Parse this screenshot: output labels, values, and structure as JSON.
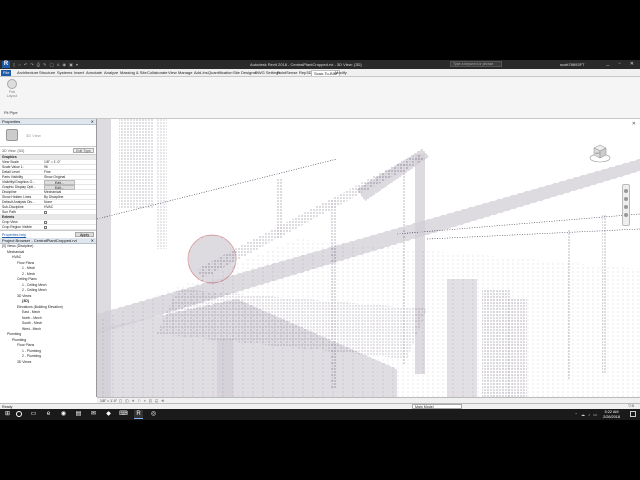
{
  "titlebar": {
    "app_logo": "R",
    "quick_access": "▯ ⌂ ↶ ↷ ⎙ ✎ ◯ A ◉ ▣ ▾",
    "title": "Autodesk Revit 2018 - CentralPlantCropped.rvt - 3D View: {3D}",
    "search_placeholder": "Type a keyword or phrase",
    "user": "scott78893FT",
    "window_buttons": "_ ▫ ✕"
  },
  "tabs": [
    "File",
    "Architecture",
    "Structure",
    "Systems",
    "Insert",
    "Annotate",
    "Analyze",
    "Massing & Site",
    "Collaborate",
    "View",
    "Manage",
    "Add-Ins",
    "Quantification",
    "Site Designer",
    "DWG Settings",
    "PointSense",
    "Rep3D",
    "Scan-To-BIM",
    "Modify"
  ],
  "active_tab": "Scan-To-BIM",
  "ribbon": {
    "button_label": "Pick Layout",
    "panel_label": "Fit Pipe"
  },
  "properties": {
    "header": "Properties",
    "type_name": "3D View",
    "filter_label": "3D View: {3D}",
    "edit_type": "Edit Type",
    "rows": [
      {
        "k": "Graphics",
        "v": "",
        "group": true
      },
      {
        "k": "View Scale",
        "v": "1/8\" = 1'-0\""
      },
      {
        "k": "Scale Value 1:",
        "v": "96"
      },
      {
        "k": "Detail Level",
        "v": "Fine"
      },
      {
        "k": "Parts Visibility",
        "v": "Show Original"
      },
      {
        "k": "Visibility/Graphics O...",
        "v": "Edit...",
        "btn": true
      },
      {
        "k": "Graphic Display Opti...",
        "v": "Edit...",
        "btn": true
      },
      {
        "k": "Discipline",
        "v": "Mechanical"
      },
      {
        "k": "Show Hidden Lines",
        "v": "By Discipline"
      },
      {
        "k": "Default Analysis Dis...",
        "v": "None"
      },
      {
        "k": "Sub-Discipline",
        "v": "HVAC"
      },
      {
        "k": "Sun Path",
        "v": "",
        "check": true
      },
      {
        "k": "Extents",
        "v": "",
        "group": true
      },
      {
        "k": "Crop View",
        "v": "",
        "check": true
      },
      {
        "k": "Crop Region Visible",
        "v": "",
        "check": true
      }
    ],
    "help_link": "Properties help",
    "apply": "Apply"
  },
  "browser": {
    "header": "Project Browser - CentralPlantCropped.rvt",
    "nodes": [
      {
        "label": "[0] Views (Discipline)",
        "indent": 0
      },
      {
        "label": "Mechanical",
        "indent": 1
      },
      {
        "label": "HVAC",
        "indent": 2
      },
      {
        "label": "Floor Plans",
        "indent": 3
      },
      {
        "label": "1 - Mech",
        "indent": 4
      },
      {
        "label": "2 - Mech",
        "indent": 4
      },
      {
        "label": "Ceiling Plans",
        "indent": 3
      },
      {
        "label": "1 - Ceiling Mech",
        "indent": 4
      },
      {
        "label": "2 - Ceiling Mech",
        "indent": 4
      },
      {
        "label": "3D Views",
        "indent": 3
      },
      {
        "label": "{3D}",
        "indent": 4,
        "bold": true
      },
      {
        "label": "Elevations (Building Elevation)",
        "indent": 3
      },
      {
        "label": "East - Mech",
        "indent": 4
      },
      {
        "label": "North - Mech",
        "indent": 4
      },
      {
        "label": "South - Mech",
        "indent": 4
      },
      {
        "label": "West - Mech",
        "indent": 4
      },
      {
        "label": "Plumbing",
        "indent": 1
      },
      {
        "label": "Plumbing",
        "indent": 2
      },
      {
        "label": "Floor Plans",
        "indent": 3
      },
      {
        "label": "1 - Plumbing",
        "indent": 4
      },
      {
        "label": "2 - Plumbing",
        "indent": 4
      },
      {
        "label": "3D Views",
        "indent": 3
      }
    ]
  },
  "viewport": {
    "view_scale": "1/8\" = 1'-0\"",
    "view_controls": "▢ ◫ ☀ ⚐ ⌖ ◰ ◱ ⟲",
    "viewcube_face": "LEFT"
  },
  "status": {
    "text": "Ready",
    "model": "Main Model",
    "filter": "▽:0"
  },
  "taskbar": {
    "apps": [
      "⊞",
      "",
      "▭",
      "e",
      "◉",
      "▤",
      "✉",
      "◆",
      "⌨",
      "R",
      "◎"
    ],
    "time": "5:22 AM",
    "date": "2/26/2018",
    "tray": "⌃ ☁ ♪ ▭"
  },
  "colors": {
    "accent": "#1e5aa8",
    "point_cloud": "#3a2e4a"
  }
}
